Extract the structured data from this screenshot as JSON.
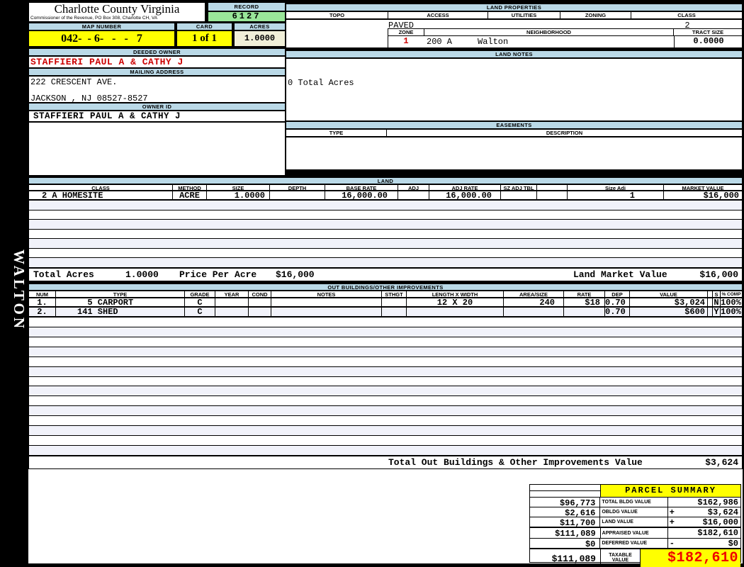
{
  "colors": {
    "bar_blue": "#bad9e7",
    "yellow": "#ffff00",
    "green": "#99e699",
    "cream": "#f0efd8",
    "stripe": "#f1f2fa",
    "owner_red": "#cc0000",
    "total_red": "#f00000"
  },
  "sidebar": {
    "vertical_label": "WALTON"
  },
  "header": {
    "county": "Charlotte County Virginia",
    "commissioner_line": "Commissioner of the Revenue, PO Box 308, Charlotte CH, VA",
    "record_label": "RECORD",
    "record_value": "6127",
    "map_number_label": "MAP NUMBER",
    "map_number_value": "042-  - 6-   -   -   7",
    "card_label": "CARD",
    "card_value": "1 of 1",
    "acres_label": "ACRES",
    "acres_value": "1.0000"
  },
  "owner": {
    "deeded_owner_label": "DEEDED OWNER",
    "deeded_owner": "STAFFIERI PAUL A & CATHY J",
    "mailing_address_label": "MAILING ADDRESS",
    "address_line1": "222 CRESCENT AVE.",
    "address_line2": "JACKSON , NJ 08527-8527",
    "owner_id_label": "OWNER ID",
    "owner_id": "STAFFIERI PAUL A & CATHY J"
  },
  "land_properties": {
    "title": "LAND PROPERTIES",
    "columns": [
      "TOPO",
      "ACCESS",
      "UTILITIES",
      "ZONING",
      "CLASS"
    ],
    "topo": "",
    "access": "PAVED",
    "utilities": "",
    "zoning": "",
    "class": "2",
    "zone_label": "ZONE",
    "zone": "1",
    "neighborhood_label": "NEIGHBORHOOD",
    "neighborhood_code": "200 A",
    "neighborhood_name": "Walton",
    "tract_size_label": "TRACT SIZE",
    "tract_size": "0.0000"
  },
  "land_notes": {
    "title": "LAND NOTES",
    "note": "0 Total Acres"
  },
  "easements": {
    "title": "EASEMENTS",
    "type_label": "TYPE",
    "description_label": "DESCRIPTION"
  },
  "land": {
    "title": "LAND",
    "columns": [
      "CLASS",
      "METHOD",
      "SIZE",
      "DEPTH",
      "BASE RATE",
      "ADJ",
      "ADJ RATE",
      "SZ ADJ TBL",
      "",
      "Size Adj",
      "MARKET VALUE"
    ],
    "rows": [
      {
        "cls": "2 A HOMESITE",
        "method": "ACRE",
        "size": "1.0000",
        "depth": "",
        "base_rate": "16,000.00",
        "adj": "",
        "adj_rate": "16,000.00",
        "sz_adj_tbl": "",
        "blank": "",
        "size_adj": "1",
        "market_value": "$16,000"
      }
    ],
    "total_acres_label": "Total Acres",
    "total_acres": "1.0000",
    "price_per_acre_label": "Price Per Acre",
    "price_per_acre": "$16,000",
    "land_market_value_label": "Land Market Value",
    "land_market_value": "$16,000"
  },
  "out_buildings": {
    "title": "OUT BUILDINGS/OTHER IMPROVEMENTS",
    "columns": [
      "NUM",
      "TYPE",
      "GRADE",
      "YEAR",
      "COND",
      "NOTES",
      "STHGT",
      "LENGTH X WIDTH",
      "AREA/SIZE",
      "RATE",
      "DEP",
      "VALUE",
      "",
      "S",
      "% COMP"
    ],
    "rows": [
      {
        "num": "1.",
        "type": "  5 CARPORT",
        "grade": "C",
        "year": "",
        "cond": "",
        "notes": "",
        "sthgt": "",
        "lxw": "12 X 20",
        "area": "240",
        "rate": "$18",
        "dep": "0.70",
        "value": "$3,024",
        "s": "N",
        "pct": "100%"
      },
      {
        "num": "2.",
        "type": "141 SHED",
        "grade": "C",
        "year": "",
        "cond": "",
        "notes": "",
        "sthgt": "",
        "lxw": "",
        "area": "",
        "rate": "",
        "dep": "0.70",
        "value": "$600",
        "s": "Y",
        "pct": "100%"
      }
    ],
    "total_label": "Total Out Buildings & Other Improvements Value",
    "total_value": "$3,624"
  },
  "parcel_summary": {
    "title": "PARCEL SUMMARY",
    "rows": [
      {
        "prior": "$96,773",
        "label": "TOTAL BLDG VALUE",
        "sign": "",
        "value": "$162,986"
      },
      {
        "prior": "$2,616",
        "label": "OBLDG VALUE",
        "sign": "+",
        "value": "$3,624"
      },
      {
        "prior": "$11,700",
        "label": "LAND VALUE",
        "sign": "+",
        "value": "$16,000"
      },
      {
        "prior": "$111,089",
        "label": "APPRAISED VALUE",
        "sign": "",
        "value": "$182,610"
      },
      {
        "prior": "$0",
        "label": "DEFERRED VALUE",
        "sign": "-",
        "value": "$0"
      }
    ],
    "taxable": {
      "prior": "$111,089",
      "label_line1": "TAXABLE",
      "label_line2": "VALUE",
      "value": "$182,610"
    }
  }
}
